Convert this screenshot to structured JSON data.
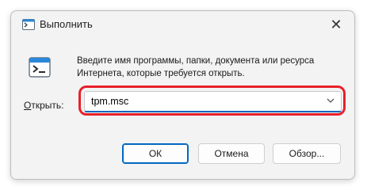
{
  "window": {
    "title": "Выполнить",
    "close_label": "✕"
  },
  "dialog": {
    "description_line1": "Введите имя программы, папки, документа или ресурса",
    "description_line2": "Интернета, которые требуется открыть.",
    "open_label_prefix": "",
    "open_label_underlined": "О",
    "open_label_rest": "ткрыть:",
    "input_value": "tpm.msc"
  },
  "buttons": {
    "ok": "ОК",
    "cancel": "Отмена",
    "browse": "Обзор..."
  },
  "colors": {
    "accent": "#0067c0",
    "highlight": "#e8202a"
  },
  "icons": {
    "app": "run-icon",
    "close": "close-icon",
    "dropdown": "chevron-down-icon"
  }
}
